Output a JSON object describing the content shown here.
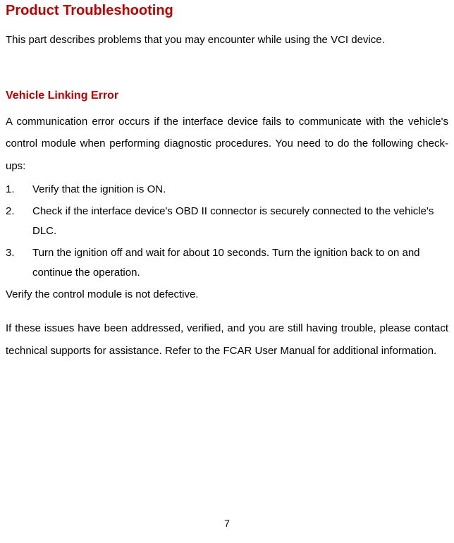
{
  "title": "Product Troubleshooting",
  "intro": "This part describes problems that you may encounter while using the VCI device.",
  "subtitle": "Vehicle Linking Error",
  "desc": "A communication error occurs if the interface device fails to communicate with the vehicle's control module when performing diagnostic procedures. You need to do the following check-ups:",
  "items": [
    {
      "num": "1.",
      "text": "Verify that the ignition is ON."
    },
    {
      "num": "2.",
      "text": "Check if the interface device's OBD II connector is securely connected to the vehicle's DLC."
    },
    {
      "num": "3.",
      "text": "Turn the ignition off and wait for about 10 seconds. Turn the ignition back to on and continue the operation."
    }
  ],
  "verify": "Verify the control module is not defective.",
  "closing": "If these issues have been addressed, verified, and you are still having trouble, please contact technical supports for assistance. Refer to the FCAR User Manual for additional information.",
  "pagenum": "7"
}
